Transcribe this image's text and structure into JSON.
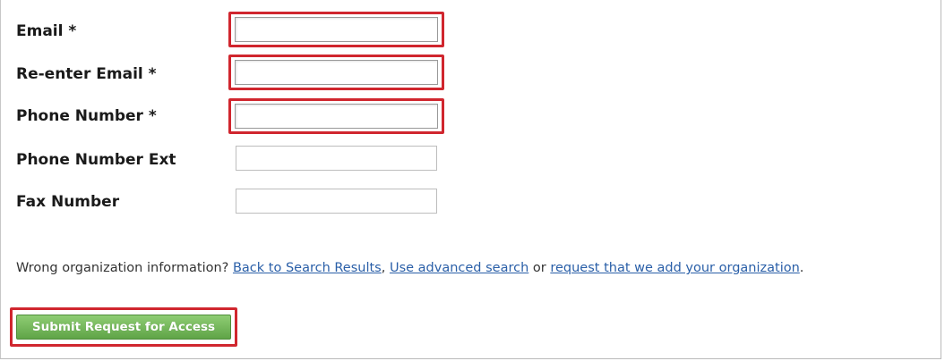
{
  "form": {
    "email": {
      "label": "Email *",
      "value": "",
      "placeholder": ""
    },
    "reenter_email": {
      "label": "Re-enter Email *",
      "value": "",
      "placeholder": ""
    },
    "phone": {
      "label": "Phone Number *",
      "value": "",
      "placeholder": ""
    },
    "phone_ext": {
      "label": "Phone Number Ext",
      "value": "",
      "placeholder": ""
    },
    "fax": {
      "label": "Fax Number",
      "value": "",
      "placeholder": ""
    }
  },
  "org_notice": {
    "prefix": "Wrong organization information? ",
    "back_link": "Back to Search Results",
    "sep1": ", ",
    "advanced_link": "Use advanced search",
    "sep2": " or ",
    "add_org_link": "request that we add your organization",
    "suffix": "."
  },
  "submit": {
    "label": "Submit Request for Access"
  },
  "colors": {
    "highlight": "#d0262e",
    "link": "#2a5fa8",
    "button": "#6fb555"
  }
}
